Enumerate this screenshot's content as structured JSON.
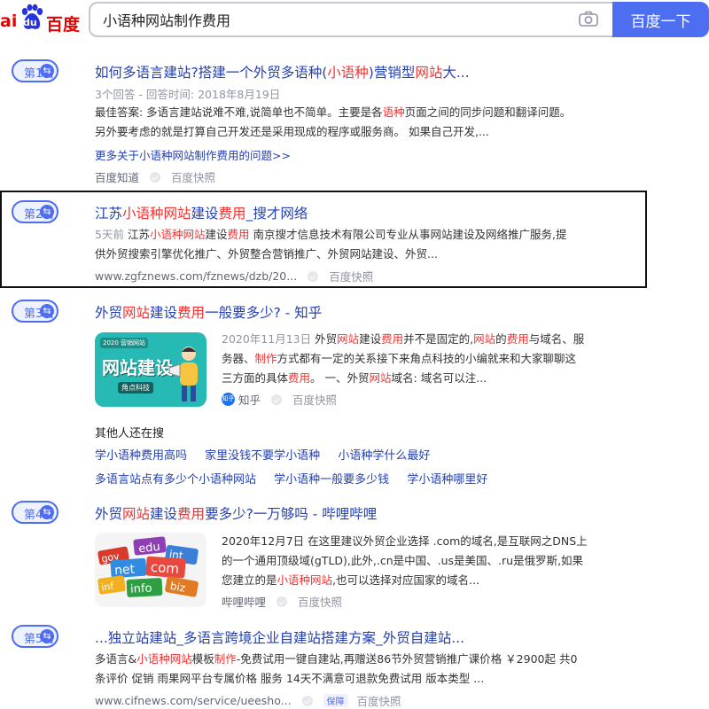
{
  "header": {
    "logo_ai": "ai",
    "logo_du": "du",
    "logo_cn": "百度",
    "search_query": "小语种网站制作费用",
    "search_button": "百度一下",
    "icons": {
      "camera": "camera-icon",
      "paw": "paw-icon"
    },
    "colors": {
      "brand_red": "#e10602",
      "brand_blue": "#4e6ef2"
    }
  },
  "results": [
    {
      "rank": "第1名",
      "title_parts": [
        "如何多语言建站?搭建一个外贸多语种(",
        "小语种",
        ")营销型",
        "网站",
        "大..."
      ],
      "meta": "3个回答 - 回答时间: 2018年8月19日",
      "text_line1_parts": [
        "最佳答案: 多语言建站说难不难,说简单也不简单。主要是各",
        "语种",
        "页面之间的同步问题和翻译问题。"
      ],
      "text_line2": "另外要考虑的就是打算自己开发还是采用现成的程序或服务商。 如果自己开发,...",
      "more_link": "更多关于小语种网站制作费用的问题>>",
      "source": "百度知道",
      "snapshot": "百度快照"
    },
    {
      "rank": "第2名",
      "title_parts": [
        "江苏",
        "小语种网站",
        "建设",
        "费用",
        "_搜才网络"
      ],
      "text_line1_parts": [
        "5天前 ",
        "江苏",
        "小语种网站",
        "建设",
        "费用",
        " 南京搜才信息技术有限公司专业从事网站建设及网络推广服务,提"
      ],
      "text_line2": "供外贸搜索引擎优化推广、外贸整合营销推广、外贸网站建设、外贸...",
      "source": "www.zgfznews.com/fznews/dzb/20...",
      "snapshot": "百度快照"
    },
    {
      "rank": "第3名",
      "title_parts": [
        "外贸",
        "网站",
        "建设",
        "费用",
        "一般要多少? - 知乎"
      ],
      "thumb_text": "网站建设",
      "thumb_top": "2020 营销网站",
      "thumb_sub": "角点科技",
      "text_line1_parts": [
        "2020年11月13日 ",
        "外贸",
        "网站",
        "建设",
        "费用",
        "并不是固定的,",
        "网站",
        "的",
        "费用",
        "与域名、服"
      ],
      "text_line2_parts": [
        "务器、",
        "制作",
        "方式都有一定的关系接下来角点科技的小编就来和大家聊聊这"
      ],
      "text_line3_parts": [
        "三方面的具体",
        "费用",
        "。 一、外贸",
        "网站",
        "域名: 域名可以注..."
      ],
      "source_icon": "知乎",
      "source": "知乎",
      "snapshot": "百度快照"
    },
    {
      "rank": "第4名",
      "title_parts": [
        "外贸",
        "网站",
        "建设",
        "费用",
        "要多少?一万够吗 - 哔哩哔哩"
      ],
      "thumb_words": [
        "edu",
        "int",
        "gov",
        "net",
        "com",
        "info",
        "biz",
        "inf"
      ],
      "text_line1": "2020年12月7日  在这里建议外贸企业选择 .com的域名,是互联网之DNS上",
      "text_line2": "的一个通用顶级域(gTLD),此外,.cn是中国、.us是美国、.ru是俄罗斯,如果",
      "text_line3_parts": [
        "您建立的是",
        "小语种网站",
        ",也可以选择对应国家的域名..."
      ],
      "source": "哔哩哔哩",
      "snapshot": "百度快照"
    },
    {
      "rank": "第5名",
      "title_parts": [
        "...独立站建站_多语言跨境企业自建站搭建方案_外贸自建站..."
      ],
      "text_line1_parts": [
        "多语言&",
        "小语种网站",
        "模板",
        "制作",
        "-免费试用一键自建站,再赠送86节外贸营销推广课价格 ￥2900起 共0"
      ],
      "text_line2": "条评价 促销 雨果网平台专属价格 服务 14天不满意可退款免费试用 版本类型 ...",
      "source": "www.cifnews.com/service/ueesho...",
      "badge": "保障",
      "snapshot": "百度快照"
    }
  ],
  "related": {
    "title": "其他人还在搜",
    "row1": [
      "学小语种费用高吗",
      "家里没钱不要学小语种",
      "小语种学什么最好"
    ],
    "row2": [
      "多语言站点有多少个小语种网站",
      "学小语种一般要多少钱",
      "学小语种哪里好"
    ]
  }
}
